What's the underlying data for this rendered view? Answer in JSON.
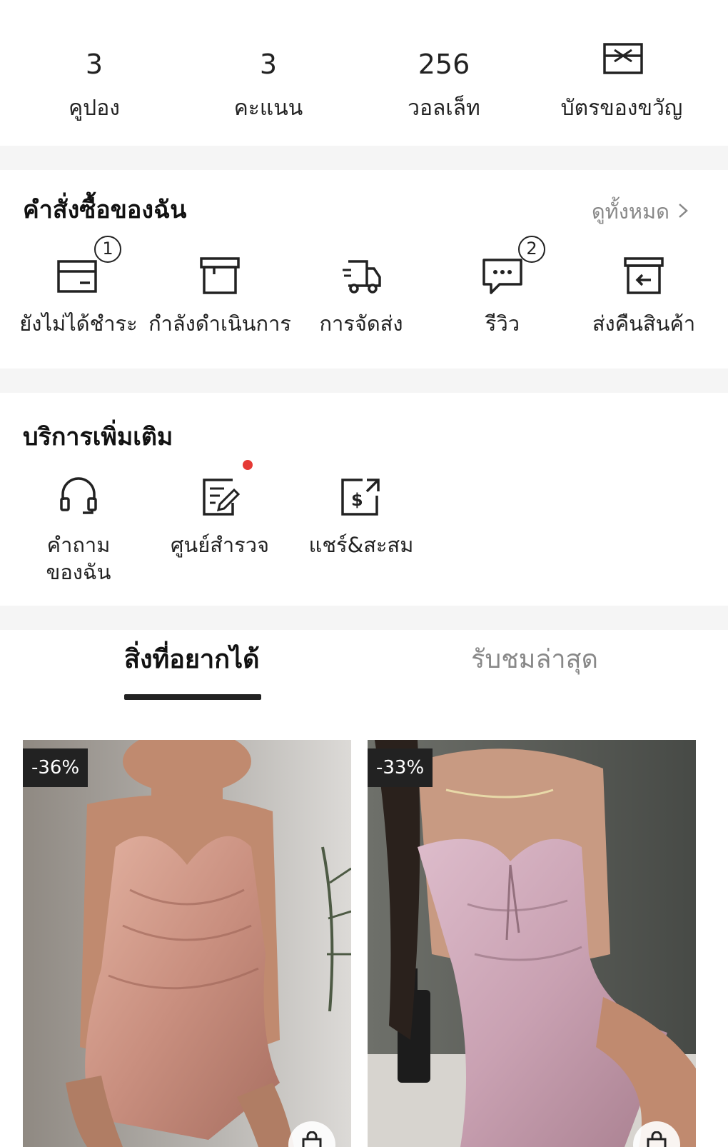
{
  "stats": [
    {
      "value": "3",
      "label": "คูปอง"
    },
    {
      "value": "3",
      "label": "คะแนน"
    },
    {
      "value": "256",
      "label": "วอลเล็ท"
    },
    {
      "label": "บัตรของขวัญ",
      "icon": "gift-card-icon"
    }
  ],
  "orders": {
    "title": "คำสั่งซื้อของฉัน",
    "view_all": "ดูทั้งหมด",
    "items": [
      {
        "label": "ยังไม่ได้ชำระ",
        "icon": "wallet-card-icon",
        "badge": "1"
      },
      {
        "label": "กำลังดำเนินการ",
        "icon": "box-icon"
      },
      {
        "label": "การจัดส่ง",
        "icon": "truck-icon"
      },
      {
        "label": "รีวิว",
        "icon": "chat-bubble-icon",
        "badge": "2"
      },
      {
        "label": "ส่งคืนสินค้า",
        "icon": "return-box-icon"
      }
    ]
  },
  "services": {
    "title": "บริการเพิ่มเติม",
    "items": [
      {
        "label": "คำถามของฉัน",
        "icon": "headset-icon"
      },
      {
        "label": "ศูนย์สำรวจ",
        "icon": "survey-edit-icon",
        "notification_dot": true
      },
      {
        "label": "แชร์&สะสม",
        "icon": "share-earn-icon"
      }
    ]
  },
  "tabs": [
    {
      "label": "สิ่งที่อยากได้",
      "active": true
    },
    {
      "label": "รับชมล่าสุด",
      "active": false
    }
  ],
  "products": [
    {
      "discount": "-36%",
      "color": "#c98f7f"
    },
    {
      "discount": "-33%",
      "color": "#c9a1b2"
    }
  ]
}
